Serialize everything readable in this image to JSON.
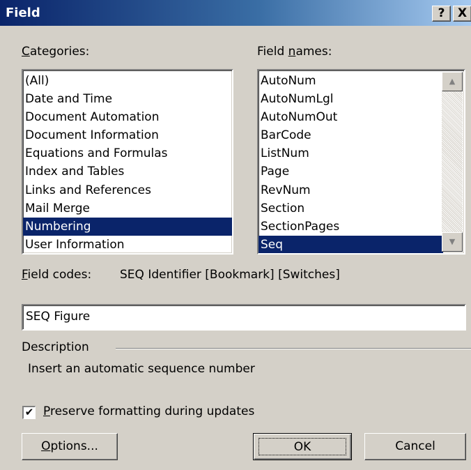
{
  "window": {
    "title": "Field",
    "help_label": "?",
    "close_label": "X"
  },
  "categories": {
    "label": "Categories:",
    "items": [
      "(All)",
      "Date and Time",
      "Document Automation",
      "Document Information",
      "Equations and Formulas",
      "Index and Tables",
      "Links and References",
      "Mail Merge",
      "Numbering",
      "User Information"
    ],
    "selected": "Numbering"
  },
  "field_names": {
    "label": "Field names:",
    "items": [
      "AutoNum",
      "AutoNumLgl",
      "AutoNumOut",
      "BarCode",
      "ListNum",
      "Page",
      "RevNum",
      "Section",
      "SectionPages",
      "Seq"
    ],
    "selected": "Seq"
  },
  "field_codes": {
    "label": "Field codes:",
    "syntax": "SEQ Identifier [Bookmark] [Switches]",
    "value": "SEQ Figure"
  },
  "description": {
    "label": "Description",
    "text": "Insert an automatic sequence number"
  },
  "preserve": {
    "label": "Preserve formatting during updates",
    "checked": true,
    "check_glyph": "✔"
  },
  "buttons": {
    "options": "Options...",
    "ok": "OK",
    "cancel": "Cancel"
  },
  "colors": {
    "dialog_bg": "#d4d0c8",
    "selection_bg": "#0a246a",
    "title_gradient_start": "#0a246a"
  }
}
